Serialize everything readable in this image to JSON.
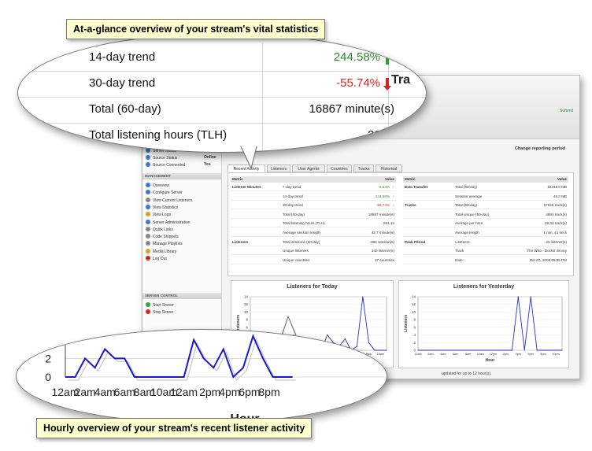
{
  "captions": {
    "top": "At-a-glance overview of your stream's vital statistics",
    "bottom": "Hourly overview of your stream's recent listener activity"
  },
  "zoom_stats": [
    {
      "label": "14-day trend",
      "value": "244.58%",
      "trend": "up"
    },
    {
      "label": "30-day trend",
      "value": "-55.74%",
      "trend": "down"
    },
    {
      "label": "Total (60-day)",
      "value": "16867 minute(s)"
    },
    {
      "label": "Total listening hours (TLH)",
      "value": "281.12"
    }
  ],
  "zoom_chart": {
    "y_ticks": [
      "2",
      "0"
    ],
    "x_ticks": [
      "12am",
      "2am",
      "4am",
      "6am",
      "8am",
      "10am",
      "12am",
      "2pm",
      "4pm",
      "6pm",
      "8pm"
    ],
    "x_label": "Hour"
  },
  "app": {
    "brand": "Tra",
    "summit": "Summit",
    "report_period": "Change reporting period",
    "status_items": [
      {
        "label": "Server Status",
        "value": "Online"
      },
      {
        "label": "Source Status",
        "value": "Online"
      },
      {
        "label": "Source Connected",
        "value": "Yes"
      }
    ],
    "management_header": "MANAGEMENT",
    "management_items": [
      "Overview",
      "Configure Server",
      "View Current Listeners",
      "View Statistics",
      "View Logs",
      "Server Administration",
      "Quick Links",
      "Code Snippets",
      "Manage Playlists",
      "Media Library",
      "Log Out"
    ],
    "server_control_header": "SERVER CONTROL",
    "server_control_items": [
      "Start Server",
      "Stop Server"
    ],
    "tabs": [
      "Recent Activity",
      "Listeners",
      "User Agents",
      "Countries",
      "Tracks",
      "Historical"
    ],
    "table_header": {
      "metric": "Metric",
      "value": "Value"
    },
    "left_table": [
      {
        "group": "Listener Minutes",
        "metric": "7-day trend",
        "value": "6.54%",
        "trend": "up"
      },
      {
        "group": "",
        "metric": "14-day trend",
        "value": "244.58%",
        "trend": "up"
      },
      {
        "group": "",
        "metric": "30-day trend",
        "value": "-55.74%",
        "trend": "down"
      },
      {
        "group": "",
        "metric": "Total (60-day)",
        "value": "16867 minute(s)"
      },
      {
        "group": "",
        "metric": "Total listening hours (TLH)",
        "value": "281.12"
      },
      {
        "group": "",
        "metric": "Average session length",
        "value": "42.7 minute(s)"
      },
      {
        "group": "Listeners",
        "metric": "Total sessions (60-day)",
        "value": "395 session(s)"
      },
      {
        "group": "",
        "metric": "Unique listeners",
        "value": "140 listener(s)"
      },
      {
        "group": "",
        "metric": "Unique countries",
        "value": "17 countries"
      }
    ],
    "right_table": [
      {
        "group": "Data Transfer",
        "metric": "Total (60-day)",
        "value": "18248.6 MB"
      },
      {
        "group": "",
        "metric": "Session average",
        "value": "46.2 MB"
      },
      {
        "group": "Tracks",
        "metric": "Total (60-day)",
        "value": "57545 track(s)"
      },
      {
        "group": "",
        "metric": "Total unique (60-day)",
        "value": "4891 track(s)"
      },
      {
        "group": "",
        "metric": "Average per hour",
        "value": "39.33 track(s)"
      },
      {
        "group": "",
        "metric": "Average length",
        "value": "1 min, 41 secs"
      },
      {
        "group": "Peak Period",
        "metric": "Listeners",
        "value": "25 listener(s)"
      },
      {
        "group": "",
        "metric": "Track",
        "value": "The Who - Doctor Jimmy"
      },
      {
        "group": "",
        "metric": "Date",
        "value": "Oct 27, 2008 09:35 PM"
      }
    ],
    "charts": [
      {
        "title": "Listeners for Today",
        "ylabel": "Listeners",
        "xlabel": "Hour"
      },
      {
        "title": "Listeners for Yesterday",
        "ylabel": "Listeners",
        "xlabel": "Hour"
      }
    ],
    "footnote": "updated for up to 12 hour(s)."
  },
  "chart_data": [
    {
      "type": "line",
      "title": "Listeners for Today",
      "xlabel": "Hour",
      "ylabel": "Listeners",
      "x": [
        "12am",
        "1am",
        "2am",
        "3am",
        "4am",
        "5am",
        "6am",
        "7am",
        "8am",
        "9am",
        "10am",
        "11am",
        "12pm",
        "1pm",
        "2pm",
        "3pm",
        "4pm",
        "5pm",
        "6pm",
        "7pm",
        "8pm",
        "9pm",
        "10pm",
        "11pm"
      ],
      "series": [
        {
          "values": [
            0,
            0,
            2,
            1,
            3,
            2,
            2,
            0,
            0,
            0,
            0,
            0,
            0,
            4,
            2,
            1,
            3,
            0,
            1,
            14,
            2,
            0,
            0,
            0
          ]
        }
      ],
      "ylim": [
        0,
        14
      ]
    },
    {
      "type": "line",
      "title": "Listeners for Yesterday",
      "xlabel": "Hour",
      "ylabel": "Listeners",
      "x": [
        "12am",
        "1am",
        "2am",
        "3am",
        "4am",
        "5am",
        "6am",
        "7am",
        "8am",
        "9am",
        "10am",
        "11am",
        "12pm",
        "1pm",
        "2pm",
        "3pm",
        "4pm",
        "5pm",
        "6pm",
        "7pm",
        "8pm",
        "9pm",
        "10pm",
        "11pm"
      ],
      "series": [
        {
          "values": [
            0,
            0,
            0,
            0,
            0,
            0,
            0,
            0,
            0,
            0,
            0,
            0,
            0,
            0,
            0,
            0,
            14,
            0,
            14,
            0,
            0,
            0,
            0,
            0
          ]
        }
      ],
      "ylim": [
        0,
        14
      ]
    }
  ]
}
